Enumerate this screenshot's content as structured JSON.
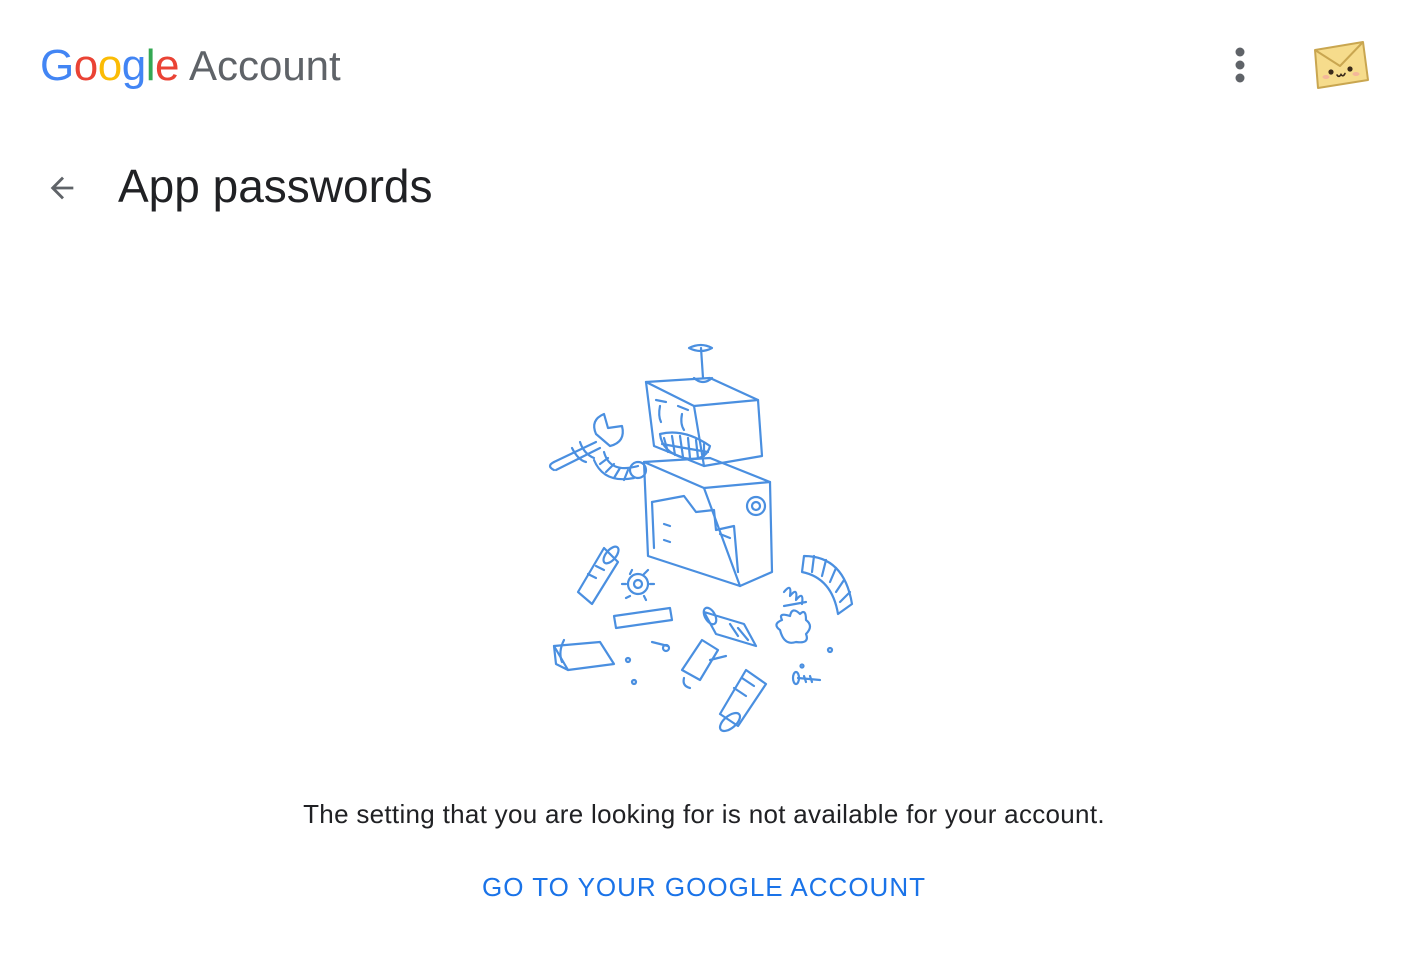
{
  "header": {
    "brand_google": "Google",
    "brand_product": "Account",
    "more_icon": "more-vert-icon",
    "avatar_icon": "envelope-avatar-icon"
  },
  "page": {
    "back_icon": "arrow-back-icon",
    "title": "App passwords"
  },
  "error": {
    "illustration": "broken-robot-illustration",
    "message": "The setting that you are looking for is not available for your account.",
    "cta_label": "GO TO YOUR GOOGLE ACCOUNT"
  },
  "colors": {
    "link": "#1a73e8",
    "text": "#202124",
    "secondary": "#5f6368",
    "sketch": "#4a8fe0"
  }
}
